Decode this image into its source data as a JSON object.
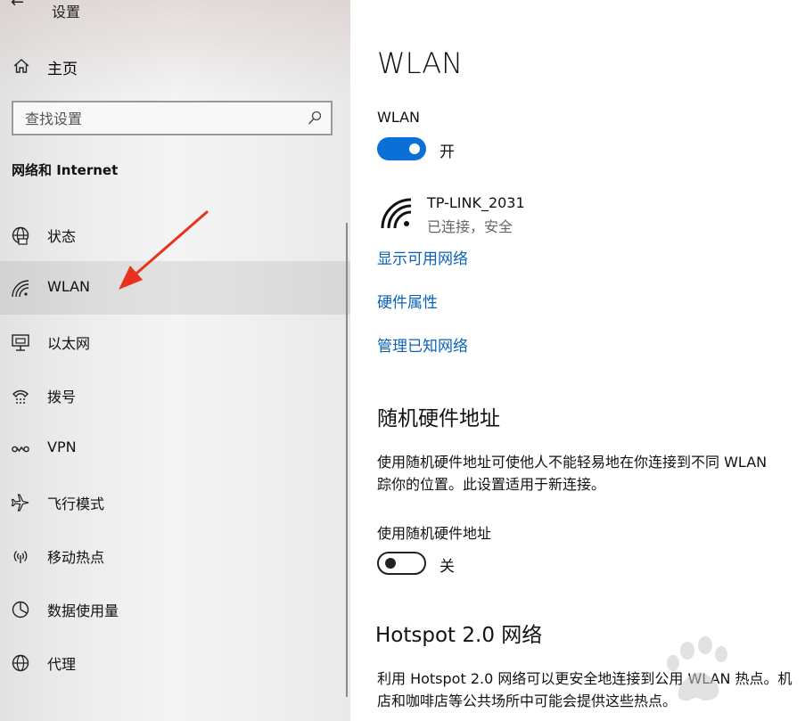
{
  "window": {
    "title": "设置"
  },
  "sidebar": {
    "home_label": "主页",
    "search_placeholder": "查找设置",
    "section_title": "网络和 Internet",
    "items": [
      {
        "label": "状态",
        "icon": "globe-icon",
        "active": false
      },
      {
        "label": "WLAN",
        "icon": "wifi-icon",
        "active": true
      },
      {
        "label": "以太网",
        "icon": "ethernet-icon",
        "active": false
      },
      {
        "label": "拨号",
        "icon": "dialup-icon",
        "active": false
      },
      {
        "label": "VPN",
        "icon": "vpn-icon",
        "active": false
      },
      {
        "label": "飞行模式",
        "icon": "airplane-icon",
        "active": false
      },
      {
        "label": "移动热点",
        "icon": "hotspot-icon",
        "active": false
      },
      {
        "label": "数据使用量",
        "icon": "data-usage-icon",
        "active": false
      },
      {
        "label": "代理",
        "icon": "proxy-globe-icon",
        "active": false
      }
    ]
  },
  "main": {
    "page_title": "WLAN",
    "wlan_label": "WLAN",
    "wlan_toggle_state": "开",
    "network": {
      "name": "TP-LINK_2031",
      "status": "已连接，安全"
    },
    "links": {
      "show_networks": "显示可用网络",
      "hardware_properties": "硬件属性",
      "manage_known": "管理已知网络"
    },
    "random_hw": {
      "heading": "随机硬件地址",
      "description_line1": "使用随机硬件地址可使他人不能轻易地在你连接到不同 WLAN",
      "description_line2": "踪你的位置。此设置适用于新连接。",
      "toggle_label": "使用随机硬件地址",
      "toggle_state": "关"
    },
    "hotspot": {
      "heading": "Hotspot 2.0 网络",
      "description_line1": "利用 Hotspot 2.0 网络可以更安全地连接到公用 WLAN 热点。机",
      "description_line2": "店和咖啡店等公共场所中可能会提供这些热点。"
    }
  },
  "colors": {
    "accent": "#0a6fd6",
    "link": "#0a63b8",
    "annotation_arrow": "#e8321e"
  }
}
